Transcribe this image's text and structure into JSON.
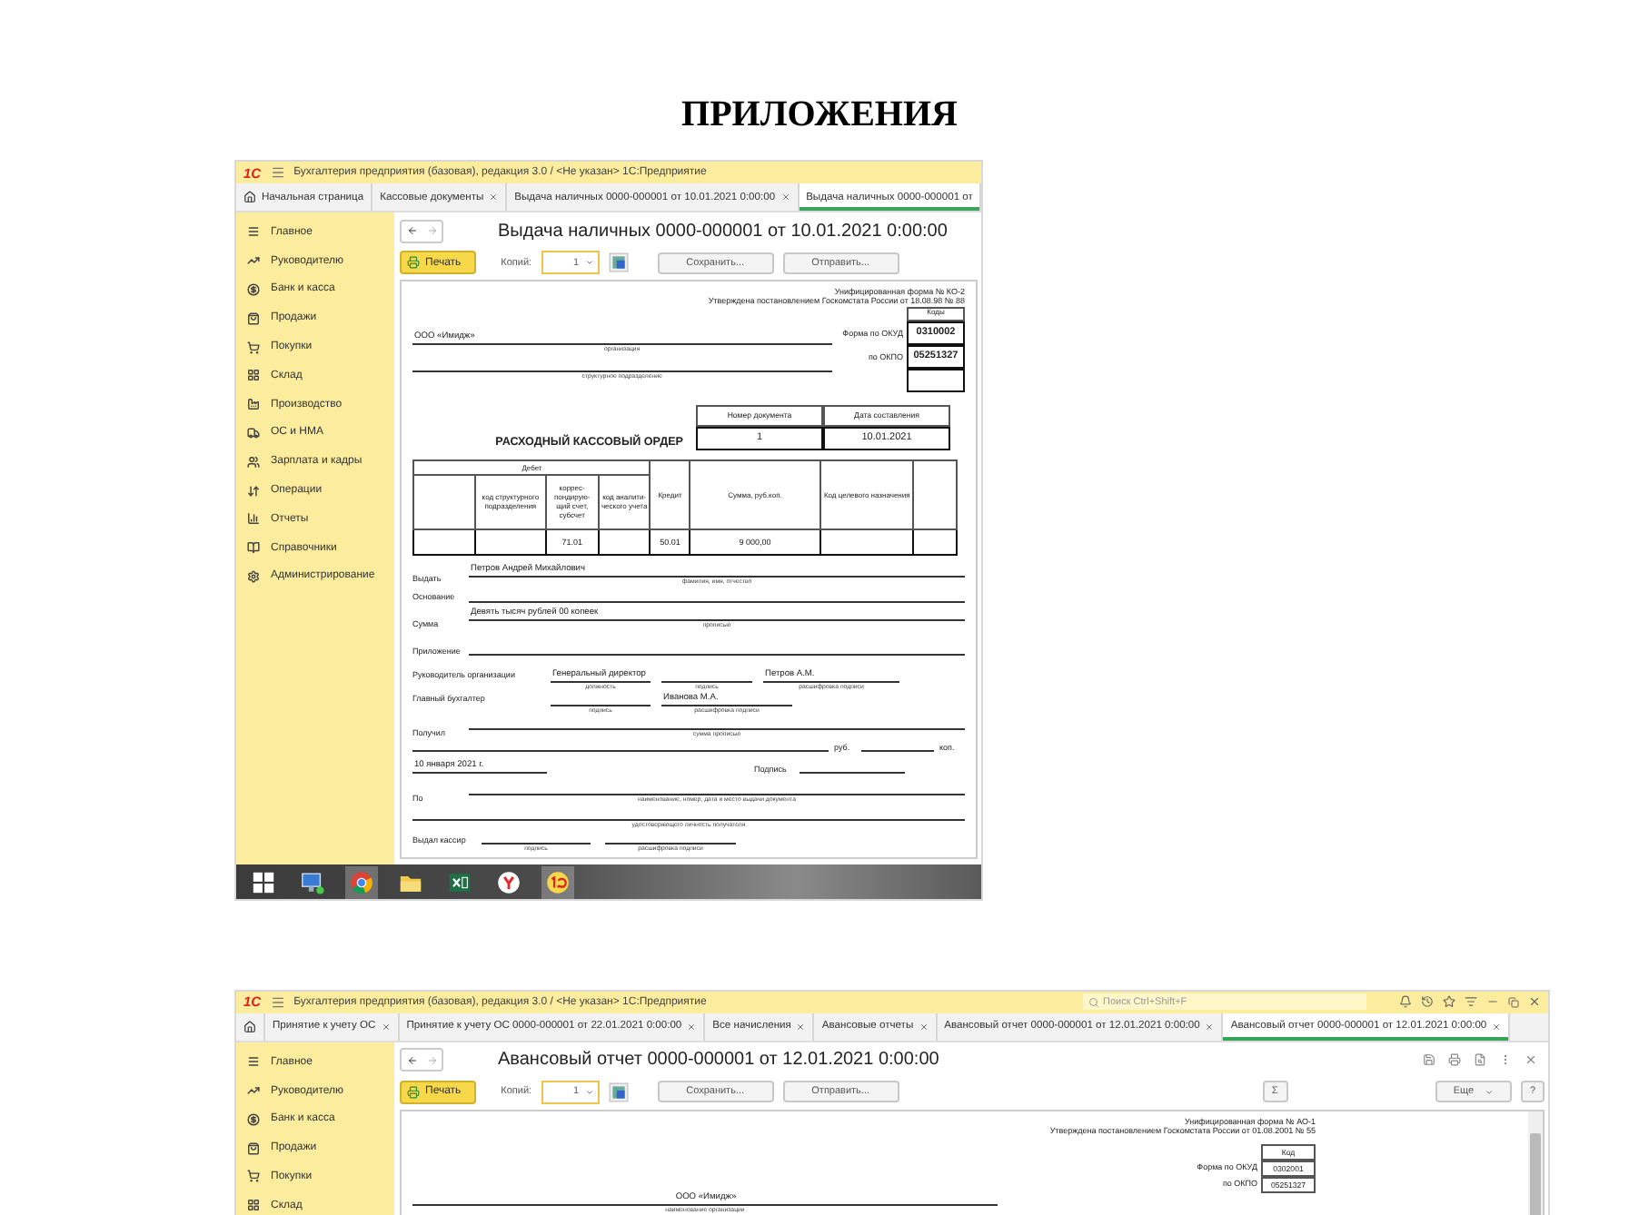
{
  "heading": "ПРИЛОЖЕНИЯ",
  "screens": [
    {
      "kind": "cash_order",
      "logo": "1С",
      "app_title": "Бухгалтерия предприятия (базовая), редакция 3.0 / <Не указан> 1С:Предприятие",
      "tabs": [
        {
          "kind": "home",
          "label": "Начальная страница",
          "closable": false,
          "selected": false
        },
        {
          "kind": "doc",
          "label": "Кассовые документы",
          "closable": true,
          "selected": false
        },
        {
          "kind": "doc",
          "label": "Выдача наличных 0000-000001 от 10.01.2021 0:00:00",
          "closable": true,
          "selected": false
        },
        {
          "kind": "doc",
          "label": "Выдача наличных 0000-000001 от",
          "closable": false,
          "selected": true
        }
      ],
      "sidebar": [
        "Главное",
        "Руководителю",
        "Банк и касса",
        "Продажи",
        "Покупки",
        "Склад",
        "Производство",
        "ОС и НМА",
        "Зарплата и кадры",
        "Операции",
        "Отчеты",
        "Справочники",
        "Администрирование"
      ],
      "doc_title": "Выдача наличных 0000-000001 от 10.01.2021 0:00:00",
      "toolbar": {
        "print": "Печать",
        "copies_label": "Копий:",
        "copies": "1",
        "save": "Сохранить...",
        "send": "Отправить..."
      },
      "form": {
        "header": [
          "Унифицированная форма № КО-2",
          "Утверждена постановлением Госкомстата России от 18.08.98 № 88"
        ],
        "codes_head": "Коды",
        "org": "ООО «Имидж»",
        "org_caption": "организация",
        "dept_caption": "структурное подразделение",
        "okud_label": "Форма по ОКУД",
        "okud": "0310002",
        "okpo_label": "по ОКПО",
        "okpo": "05251327",
        "number_head": "Номер документа",
        "date_head": "Дата составления",
        "title": "РАСХОДНЫЙ КАССОВЫЙ ОРДЕР",
        "number": "1",
        "date": "10.01.2021",
        "debit_head": "Дебет",
        "columns": {
          "column_2": "код структурного подразделения",
          "column_3": "коррес-пондирую-щий счет, субсчет",
          "column_4": "код аналити-ческого учета",
          "column_5": "Кредит",
          "column_6": "Сумма, руб.коп.",
          "column_7": "Код целевого назначения"
        },
        "row": {
          "column_3": "71.01",
          "column_5": "50.01",
          "column_6": "9 000,00"
        },
        "fields": [
          {
            "label": "Выдать",
            "value": "Петров Андрей Михайлович",
            "caption": "фамилия, имя, отчество"
          },
          {
            "label": "Основание"
          },
          {
            "label": "Сумма",
            "value": "Девять тысяч рублей 00 копеек",
            "caption": "прописью"
          },
          {
            "label": "Приложение"
          }
        ],
        "head_label": "Руководитель организации",
        "head_slots": [
          {
            "value": "Генеральный директор",
            "caption": "должность"
          },
          {
            "caption": "подпись"
          },
          {
            "value": "Петров А.М.",
            "caption": "расшифровка подписи"
          }
        ],
        "accountant_label": "Главный бухгалтер",
        "accountant_slots": [
          {
            "caption": "подпись"
          },
          {
            "value": "Иванова М.А.",
            "caption": "расшифровка подписи"
          }
        ],
        "received_label": "Получил",
        "received_caption": "сумма прописью",
        "rub": "руб.",
        "kop": "коп.",
        "date_text": "10 января 2021 г.",
        "signature_label": "Подпись",
        "doc_label": "По",
        "doc_caption": "наименование, номер, дата и место выдачи документа",
        "doc_caption2": "удостоверяющего личность получателя",
        "cashier_label": "Выдал кассир",
        "cashier_slots": [
          {
            "caption": "подпись"
          },
          {
            "caption": "расшифровка подписи"
          }
        ]
      },
      "taskbar": true
    },
    {
      "kind": "advance_report",
      "logo": "1С",
      "app_title": "Бухгалтерия предприятия (базовая), редакция 3.0 / <Не указан> 1С:Предприятие",
      "search_placeholder": "Поиск Ctrl+Shift+F",
      "title_icons": true,
      "tabs": [
        {
          "kind": "home",
          "closable": false,
          "selected": false
        },
        {
          "kind": "doc",
          "label": "Принятие к учету ОС",
          "closable": true,
          "selected": false
        },
        {
          "kind": "doc",
          "label": "Принятие к учету ОС 0000-000001 от 22.01.2021 0:00:00",
          "closable": true,
          "selected": false
        },
        {
          "kind": "doc",
          "label": "Все начисления",
          "closable": true,
          "selected": false
        },
        {
          "kind": "doc",
          "label": "Авансовые отчеты",
          "closable": true,
          "selected": false
        },
        {
          "kind": "doc",
          "label": "Авансовый отчет 0000-000001 от 12.01.2021 0:00:00",
          "closable": true,
          "selected": false
        },
        {
          "kind": "doc",
          "label": "Авансовый отчет 0000-000001 от 12.01.2021 0:00:00",
          "closable": true,
          "selected": true
        }
      ],
      "sidebar": [
        "Главное",
        "Руководителю",
        "Банк и касса",
        "Продажи",
        "Покупки",
        "Склад"
      ],
      "doc_title": "Авансовый отчет 0000-000001 от 12.01.2021 0:00:00",
      "doc_icons": true,
      "toolbar": {
        "print": "Печать",
        "copies_label": "Копий:",
        "copies": "1",
        "save": "Сохранить...",
        "send": "Отправить...",
        "sum": "Σ",
        "more": "Еще",
        "help": "?"
      },
      "form": {
        "header": [
          "Унифицированная форма № АО-1",
          "Утверждена постановлением Госкомстата России от  01.08.2001 № 55"
        ],
        "codes_head": "Код",
        "okud_label": "Форма по ОКУД",
        "okud": "0302001",
        "okpo_label": "по ОКПО",
        "okpo": "05251327",
        "org": "ООО «Имидж»",
        "org_caption": "наименование организации"
      }
    }
  ]
}
